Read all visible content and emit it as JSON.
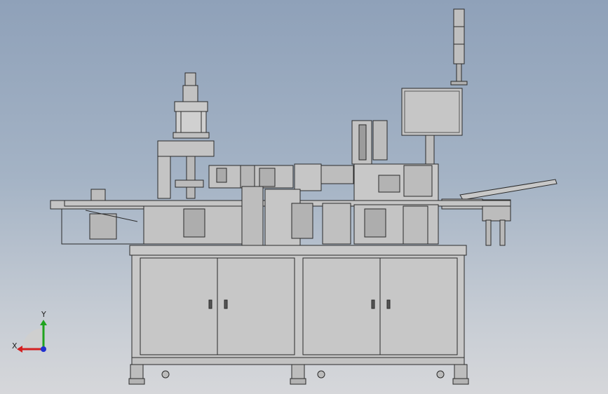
{
  "viewport": {
    "background_top": "#8fa1b9",
    "background_bottom": "#d6d7da",
    "part_color": "#c4c4c4",
    "edge_color": "#2a2a2a"
  },
  "triad": {
    "x_label": "X",
    "y_label": "Y",
    "x_color": "#d42020",
    "y_color": "#1fa31f",
    "z_color": "#2030d0"
  }
}
